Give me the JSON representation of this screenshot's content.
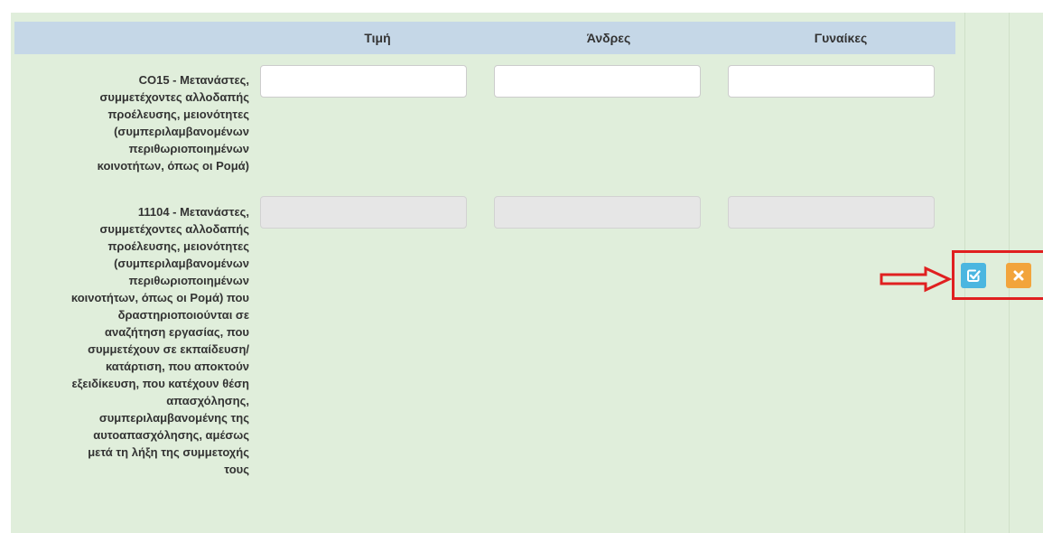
{
  "table": {
    "columns": [
      "",
      "Τιμή",
      "Άνδρες",
      "Γυναίκες"
    ],
    "rows": [
      {
        "label": "CO15 - Μετανάστες,\nσυμμετέχοντες αλλοδαπής\nπροέλευσης, μειονότητες\n(συμπεριλαμβανομένων\nπεριθωριοποιημένων\nκοινοτήτων, όπως οι Ρομά)",
        "editable": true,
        "values": [
          "",
          "",
          ""
        ]
      },
      {
        "label": "11104 - Μετανάστες,\nσυμμετέχοντες αλλοδαπής\nπροέλευσης, μειονότητες\n(συμπεριλαμβανομένων\nπεριθωριοποιημένων\nκοινοτήτων, όπως οι Ρομά) που\nδραστηριοποιούνται σε\nαναζήτηση εργασίας, που\nσυμμετέχουν σε εκπαίδευση/\nκατάρτιση, που αποκτούν\nεξειδίκευση, που κατέχουν θέση\nαπασχόλησης,\nσυμπεριλαμβανομένης της\nαυτοαπασχόλησης, αμέσως\nμετά τη λήξη της συμμετοχής\nτους",
        "editable": false,
        "values": [
          "",
          "",
          ""
        ]
      }
    ]
  },
  "actions": {
    "edit_icon": "edit-check-icon",
    "cancel_icon": "close-icon"
  },
  "annotation": {
    "arrow_icon": "red-outline-arrow-icon",
    "color": "#e02020"
  },
  "colors": {
    "panel_background": "#e0eedb",
    "header_background": "#c5d7e7",
    "edit_button": "#4bb6e0",
    "cancel_button": "#f2a43c"
  }
}
